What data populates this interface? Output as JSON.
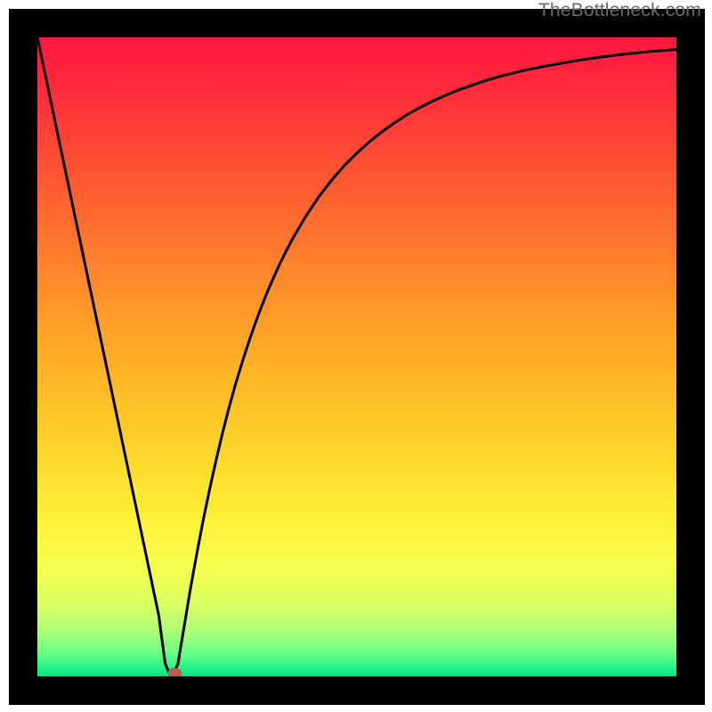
{
  "watermark": "TheBottleneck.com",
  "chart_data": {
    "type": "line",
    "title": "",
    "xlabel": "",
    "ylabel": "",
    "xlim": [
      0,
      100
    ],
    "ylim": [
      0,
      100
    ],
    "x": [
      0,
      1,
      2,
      3,
      4,
      5,
      6,
      7,
      8,
      9,
      10,
      11,
      12,
      13,
      14,
      15,
      16,
      17,
      18,
      19,
      20,
      20.5,
      21,
      21.5,
      22,
      23,
      24,
      25,
      26,
      27,
      28,
      29,
      30,
      31,
      32,
      33,
      34,
      35,
      36,
      37,
      38,
      39,
      40,
      42,
      44,
      46,
      48,
      50,
      52,
      54,
      56,
      58,
      60,
      62,
      64,
      66,
      68,
      70,
      72,
      74,
      76,
      78,
      80,
      82,
      84,
      86,
      88,
      90,
      92,
      94,
      96,
      98,
      100
    ],
    "values": [
      100,
      95.24,
      90.48,
      85.71,
      80.95,
      76.19,
      71.43,
      66.67,
      61.9,
      57.14,
      52.38,
      47.62,
      42.86,
      38.1,
      33.33,
      28.57,
      23.81,
      19.05,
      14.29,
      9.52,
      2.0,
      0.8,
      0.5,
      0.8,
      2.0,
      8.0,
      14.0,
      19.5,
      24.7,
      29.5,
      34.0,
      38.2,
      42.1,
      45.7,
      49.0,
      52.1,
      55.0,
      57.7,
      60.2,
      62.5,
      64.7,
      66.7,
      68.6,
      72.0,
      75.0,
      77.6,
      79.9,
      81.9,
      83.7,
      85.3,
      86.7,
      88.0,
      89.1,
      90.1,
      91.0,
      91.8,
      92.5,
      93.2,
      93.8,
      94.3,
      94.8,
      95.2,
      95.6,
      95.95,
      96.3,
      96.6,
      96.9,
      97.15,
      97.4,
      97.6,
      97.8,
      97.95,
      98.1
    ],
    "marker": {
      "x": 21.5,
      "y": 0.5,
      "color": "#c15a4e"
    },
    "gradient_stops": [
      {
        "offset": 0.0,
        "color": "#ff163f"
      },
      {
        "offset": 0.08,
        "color": "#ff2b3c"
      },
      {
        "offset": 0.18,
        "color": "#ff4a35"
      },
      {
        "offset": 0.28,
        "color": "#ff6a2f"
      },
      {
        "offset": 0.38,
        "color": "#ff8a2b"
      },
      {
        "offset": 0.48,
        "color": "#ffa828"
      },
      {
        "offset": 0.58,
        "color": "#ffc328"
      },
      {
        "offset": 0.68,
        "color": "#ffdd2e"
      },
      {
        "offset": 0.76,
        "color": "#fff23a"
      },
      {
        "offset": 0.83,
        "color": "#f6ff4e"
      },
      {
        "offset": 0.89,
        "color": "#d8ff64"
      },
      {
        "offset": 0.93,
        "color": "#aaff78"
      },
      {
        "offset": 0.965,
        "color": "#66ff88"
      },
      {
        "offset": 1.0,
        "color": "#00e882"
      }
    ]
  }
}
